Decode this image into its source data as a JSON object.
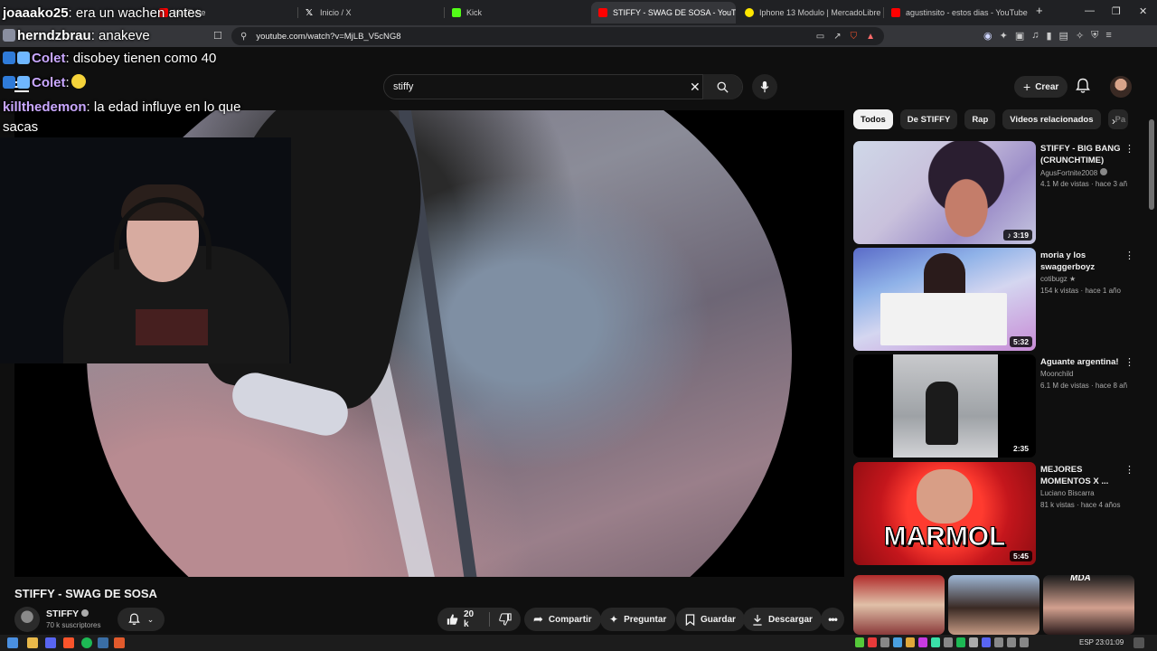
{
  "browser": {
    "tabs": [
      {
        "title": "YouTube",
        "favicon_color": "#ff0000",
        "active": false
      },
      {
        "title": "Inicio / X",
        "favicon_color": "#ffffff",
        "active": false
      },
      {
        "title": "Kick",
        "favicon_color": "#53fc18",
        "active": false
      },
      {
        "title": "STIFFY - SWAG DE SOSA - YouTu",
        "favicon_color": "#ff0000",
        "active": true
      },
      {
        "title": "Iphone 13 Modulo | MercadoLibre",
        "favicon_color": "#ffe600",
        "active": false
      },
      {
        "title": "agustinsito - estos dias - YouTube",
        "favicon_color": "#ff0000",
        "active": false
      }
    ],
    "new_tab_label": "+",
    "url": "youtube.com/watch?v=MjLB_V5cNG8"
  },
  "chat": [
    {
      "user": "joaaako25",
      "message": "era un wachen antes",
      "user_color": "#ffffff"
    },
    {
      "user": "herndzbrau",
      "message": "anakeve",
      "user_color": "#ffffff"
    },
    {
      "user": "Colet",
      "message": "disobey tienen como 40",
      "user_color": "#c9a7ff"
    },
    {
      "user": "Colet",
      "message": "",
      "user_color": "#c9a7ff"
    },
    {
      "user": "killthedemon",
      "message": "la edad influye en lo que",
      "user_color": "#c9a7ff"
    },
    {
      "user": "",
      "message": "sacas",
      "user_color": "#ffffff"
    }
  ],
  "header": {
    "search_value": "stiffy",
    "create_label": "Crear"
  },
  "video": {
    "title": "STIFFY - SWAG DE SOSA",
    "channel": "STIFFY",
    "subscribers": "70 k suscriptores",
    "likes": "20 k",
    "share_label": "Compartir",
    "ask_label": "Preguntar",
    "save_label": "Guardar",
    "download_label": "Descargar"
  },
  "chips": [
    "Todos",
    "De STIFFY",
    "Rap",
    "Videos relacionados",
    "Pa"
  ],
  "recommendations": [
    {
      "title": "STIFFY - BIG BANG (CRUNCHTIME)",
      "channel": "AgusFortnite2008",
      "meta": "4.1 M de vistas · hace 3 añ",
      "duration": "♪ 3:19"
    },
    {
      "title": "moria y los swaggerboyz",
      "channel": "cotibugz ★",
      "meta": "154 k vistas · hace 1 año",
      "duration": "5:32"
    },
    {
      "title": "Aguante argentina!",
      "channel": "Moonchild",
      "meta": "6.1 M de vistas · hace 8 añ",
      "duration": "2:35"
    },
    {
      "title": "MEJORES MOMENTOS X ...",
      "channel": "Luciano Biscarra",
      "meta": "81 k vistas · hace 4 años",
      "duration": "5:45",
      "thumb_text": "MARMOL"
    }
  ],
  "shorts_badge": "MDA",
  "taskbar": {
    "language": "ESP",
    "time": "23:01:09"
  },
  "colors": {
    "yt_bg": "#0f0f0f",
    "pill_bg": "#272727",
    "accent_red": "#ff0000"
  }
}
